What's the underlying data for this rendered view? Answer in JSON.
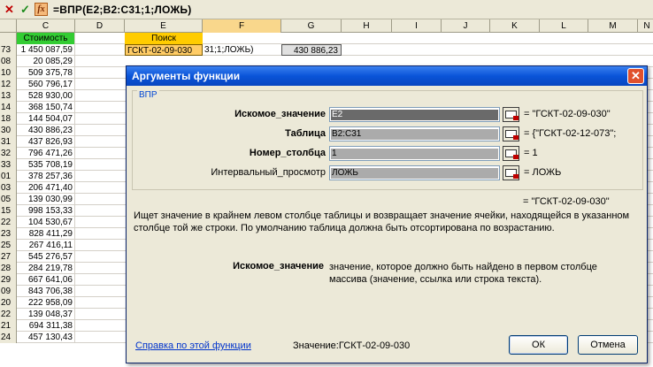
{
  "formula_bar": {
    "cancel_icon": "x-icon",
    "confirm_icon": "check-icon",
    "fx_label": "fx",
    "formula": "=ВПР(E2;B2:C31;1;ЛОЖЬ)"
  },
  "columns": [
    "C",
    "D",
    "E",
    "F",
    "G",
    "H",
    "I",
    "J",
    "K",
    "L",
    "M",
    "N"
  ],
  "sheet": {
    "c_header": "Стоимость",
    "e_header": "Поиск",
    "e_value": "ГСКТ-02-09-030",
    "f_value": "31;1;ЛОЖЬ)",
    "g_value": "430 886,23",
    "rows": [
      {
        "n": "73",
        "v": "1 450 087,59"
      },
      {
        "n": "08",
        "v": "20 085,29"
      },
      {
        "n": "10",
        "v": "509 375,78"
      },
      {
        "n": "12",
        "v": "560 796,17"
      },
      {
        "n": "13",
        "v": "528 930,00"
      },
      {
        "n": "14",
        "v": "368 150,74"
      },
      {
        "n": "18",
        "v": "144 504,07"
      },
      {
        "n": "30",
        "v": "430 886,23"
      },
      {
        "n": "31",
        "v": "437 826,93"
      },
      {
        "n": "32",
        "v": "796 471,26"
      },
      {
        "n": "33",
        "v": "535 708,19"
      },
      {
        "n": "01",
        "v": "378 257,36"
      },
      {
        "n": "03",
        "v": "206 471,40"
      },
      {
        "n": "05",
        "v": "139 030,99"
      },
      {
        "n": "15",
        "v": "998 153,33"
      },
      {
        "n": "22",
        "v": "104 530,67"
      },
      {
        "n": "23",
        "v": "828 411,29"
      },
      {
        "n": "25",
        "v": "267 416,11"
      },
      {
        "n": "27",
        "v": "545 276,57"
      },
      {
        "n": "28",
        "v": "284 219,78"
      },
      {
        "n": "29",
        "v": "667 641,06"
      },
      {
        "n": "09",
        "v": "843 706,38"
      },
      {
        "n": "20",
        "v": "222 958,09"
      },
      {
        "n": "22",
        "v": "139 048,37"
      },
      {
        "n": "21",
        "v": "694 311,38"
      },
      {
        "n": "24",
        "v": "457 130,43"
      }
    ]
  },
  "dialog": {
    "title": "Аргументы функции",
    "group": "ВПР",
    "args": [
      {
        "label": "Искомое_значение",
        "value": "E2",
        "result": "= \"ГСКТ-02-09-030\""
      },
      {
        "label": "Таблица",
        "value": "B2:C31",
        "result": "= {\"ГСКТ-02-12-073\";"
      },
      {
        "label": "Номер_столбца",
        "value": "1",
        "result": "= 1"
      },
      {
        "label": "Интервальный_просмотр",
        "value": "ЛОЖЬ",
        "result": "= ЛОЖЬ"
      }
    ],
    "formula_result": "= \"ГСКТ-02-09-030\"",
    "description": "Ищет значение в крайнем левом столбце таблицы и возвращает значение ячейки, находящейся в указанном столбце той же строки. По умолчанию таблица должна быть отсортирована по возрастанию.",
    "arg_name": "Искомое_значение",
    "arg_desc": "значение, которое должно быть найдено в первом столбце массива (значение, ссылка или строка текста).",
    "help_link": "Справка по этой функции",
    "value_label": "Значение:",
    "value": "ГСКТ-02-09-030",
    "ok": "ОК",
    "cancel": "Отмена"
  }
}
